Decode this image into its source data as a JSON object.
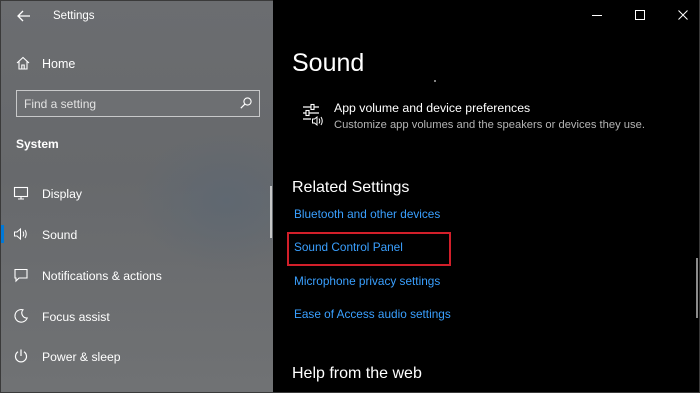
{
  "app": {
    "title": "Settings"
  },
  "sidebar": {
    "home_label": "Home",
    "search_placeholder": "Find a setting",
    "section_title": "System",
    "items": [
      {
        "label": "Display",
        "icon": "display-icon"
      },
      {
        "label": "Sound",
        "icon": "sound-icon",
        "active": true
      },
      {
        "label": "Notifications & actions",
        "icon": "notifications-icon"
      },
      {
        "label": "Focus assist",
        "icon": "focus-assist-icon"
      },
      {
        "label": "Power & sleep",
        "icon": "power-icon"
      }
    ]
  },
  "main": {
    "title": "Sound",
    "pref": {
      "title": "App volume and device preferences",
      "subtitle": "Customize app volumes and the speakers or devices they use."
    },
    "related_title": "Related Settings",
    "related_links": [
      "Bluetooth and other devices",
      "Sound Control Panel",
      "Microphone privacy settings",
      "Ease of Access audio settings"
    ],
    "help_title": "Help from the web"
  },
  "colors": {
    "accent": "#0078d7",
    "link": "#3aa0ff",
    "highlight": "#d21f2a"
  }
}
